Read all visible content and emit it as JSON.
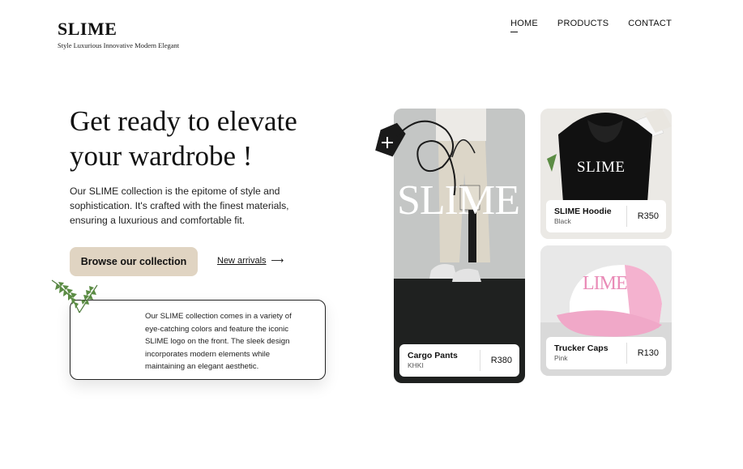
{
  "header": {
    "brand": "SLIME",
    "tagline": "Style Luxurious Innovative Modern Elegant",
    "nav": [
      {
        "label": "HOME",
        "active": true
      },
      {
        "label": "PRODUCTS",
        "active": false
      },
      {
        "label": "CONTACT",
        "active": false
      }
    ]
  },
  "hero": {
    "title": "Get ready to elevate your wardrobe !",
    "description": "Our SLIME collection is the epitome of style and sophistication. It's crafted with the finest materials, ensuring a luxurious and comfortable fit.",
    "primary_button": "Browse our collection",
    "secondary_link": "New arrivals",
    "arrow": "⟶"
  },
  "info": {
    "text": "Our SLIME collection comes in a variety of eye-catching colors and feature the iconic SLIME logo on the front. The sleek design incorporates modern elements while maintaining an elegant aesthetic."
  },
  "products": [
    {
      "name": "Cargo Pants",
      "color": "KHKI",
      "price": "R380",
      "watermark": "SLIME"
    },
    {
      "name": "SLIME Hoodie",
      "color": "Black",
      "price": "R350",
      "print": "SLIME"
    },
    {
      "name": "Trucker Caps",
      "color": "Pink",
      "price": "R130",
      "print": "LIME"
    }
  ],
  "colors": {
    "button_bg": "#e0d4c2",
    "text": "#111111",
    "cap_pink": "#f0a8c8"
  },
  "icons": [
    "price-tag-icon",
    "plus-icon",
    "arrow-right-icon",
    "leaf-icon"
  ]
}
